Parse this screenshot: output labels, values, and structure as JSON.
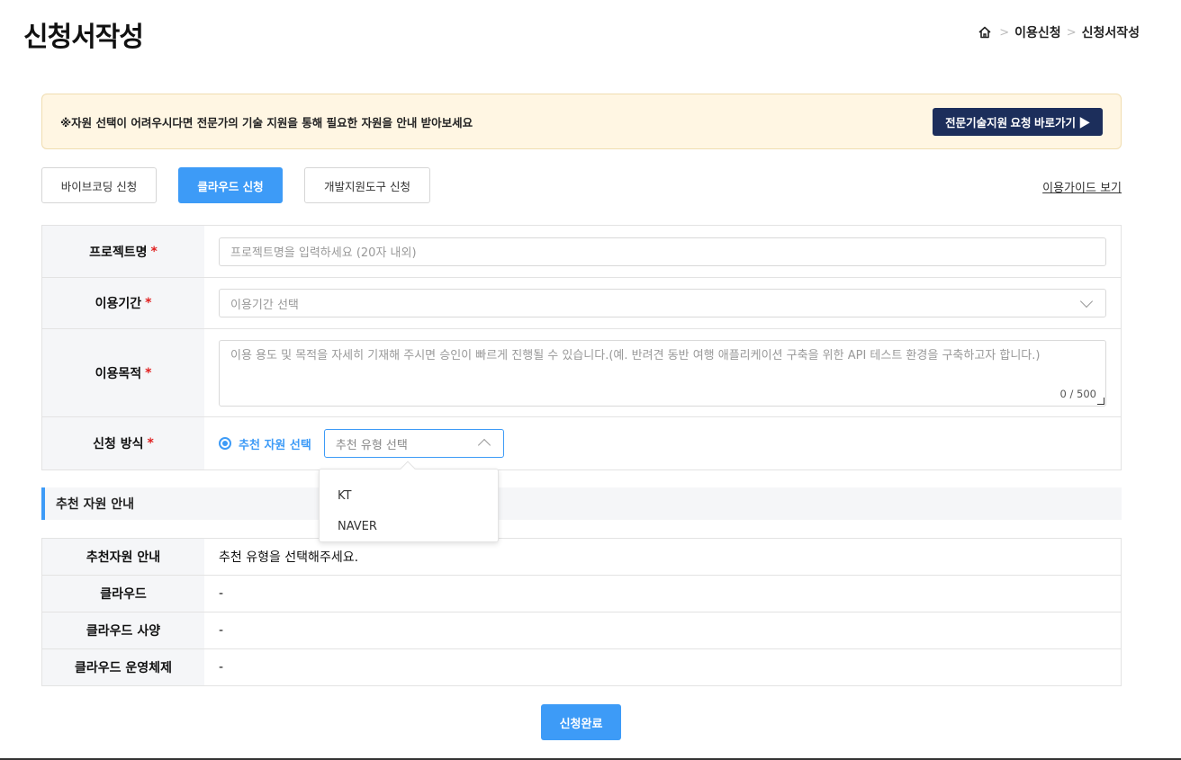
{
  "header": {
    "title": "신청서작성",
    "breadcrumb": [
      "이용신청",
      "신청서작성"
    ]
  },
  "notice": {
    "message": "※자원 선택이 어려우시다면 전문가의 기술 지원을 통해 필요한 자원을 안내 받아보세요",
    "cta_label": "전문기술지원 요청 바로가기 ▶"
  },
  "tabs": [
    {
      "label": "바이브코딩 신청",
      "active": false
    },
    {
      "label": "클라우드 신청",
      "active": true
    },
    {
      "label": "개발지원도구 신청",
      "active": false
    }
  ],
  "guide_link": "이용가이드 보기",
  "form": {
    "required_mark": "*",
    "project_name": {
      "label": "프로젝트명",
      "placeholder": "프로젝트명을 입력하세요 (20자 내외)"
    },
    "period": {
      "label": "이용기간",
      "placeholder": "이용기간 선택"
    },
    "purpose": {
      "label": "이용목적",
      "placeholder": "이용 용도 및 목적을 자세히 기재해 주시면 승인이 빠르게 진행될 수 있습니다.(예. 반려견 동반 여행 애플리케이션 구축을 위한 API 테스트 환경을 구축하고자 합니다.)",
      "counter": "0 / 500"
    },
    "method": {
      "label": "신청 방식",
      "radio_label": "추천 자원 선택",
      "select_placeholder": "추천 유형 선택"
    }
  },
  "dropdown_options": [
    "KT",
    "NAVER"
  ],
  "section_title": "추천 자원 안내",
  "info_rows": [
    {
      "label": "추천자원 안내",
      "value": "추천 유형을 선택해주세요."
    },
    {
      "label": "클라우드",
      "value": "-"
    },
    {
      "label": "클라우드 사양",
      "value": "-"
    },
    {
      "label": "클라우드 운영체제",
      "value": "-"
    }
  ],
  "submit_label": "신청완료",
  "colors": {
    "accent": "#3d9bf7",
    "navy": "#1c2e5b",
    "notice_bg": "#fff6e3",
    "required": "#e02020"
  }
}
